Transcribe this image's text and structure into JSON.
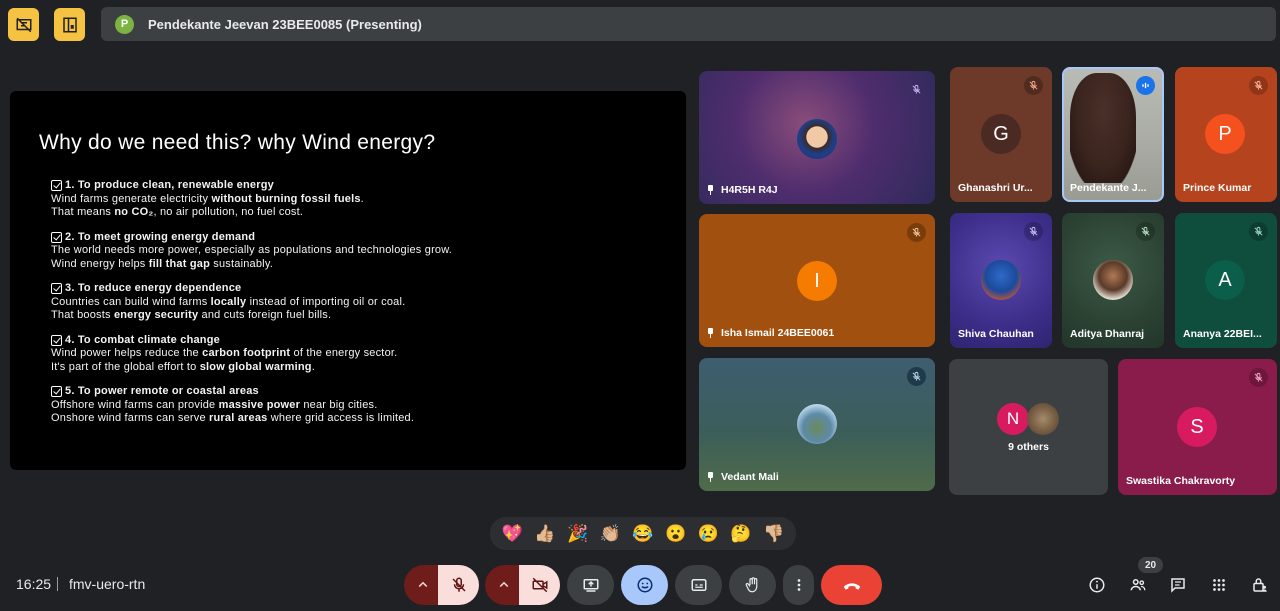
{
  "presenter": {
    "initial": "P",
    "label": "Pendekante Jeevan 23BEE0085 (Presenting)"
  },
  "slide": {
    "title": "Why do we need this? why Wind energy?",
    "points": [
      {
        "heading": "1. To produce clean, renewable energy",
        "line1": [
          "Wind farms generate electricity ",
          "without burning fossil fuels",
          "."
        ],
        "line2": [
          "That means ",
          "no CO₂",
          ", no air pollution, no fuel cost."
        ]
      },
      {
        "heading": "2. To meet growing energy demand",
        "line1": [
          "The world needs more power, especially as populations and technologies grow.",
          "",
          ""
        ],
        "line2": [
          "Wind energy helps ",
          "fill that gap",
          " sustainably."
        ]
      },
      {
        "heading": "3. To reduce energy dependence",
        "line1": [
          "Countries can build wind farms ",
          "locally",
          " instead of importing oil or coal."
        ],
        "line2": [
          "That boosts ",
          "energy security",
          " and cuts foreign fuel bills."
        ]
      },
      {
        "heading": "4. To combat climate change",
        "line1": [
          "Wind power helps reduce the ",
          "carbon footprint",
          " of the energy sector."
        ],
        "line2": [
          "It's part of the global effort to ",
          "slow global warming",
          "."
        ]
      },
      {
        "heading": "5. To power remote or coastal areas",
        "line1": [
          "Offshore wind farms can provide ",
          "massive power",
          " near big cities."
        ],
        "line2": [
          "Onshore wind farms can serve ",
          "rural areas",
          " where grid access is limited."
        ]
      }
    ]
  },
  "participants": {
    "h4r5h": "H4R5H R4J",
    "ghanashri": {
      "name": "Ghanashri Ur...",
      "initial": "G"
    },
    "pendekante": "Pendekante J...",
    "prince": {
      "name": "Prince Kumar",
      "initial": "P"
    },
    "isha": {
      "name": "Isha Ismail 24BEE0061",
      "initial": "I"
    },
    "shiva": "Shiva Chauhan",
    "aditya": "Aditya Dhanraj",
    "ananya": {
      "name": "Ananya 22BEI...",
      "initial": "A"
    },
    "vedant": "Vedant Mali",
    "others": {
      "label": "9 others",
      "initial": "N"
    },
    "swastika": {
      "name": "Swastika Chakravorty",
      "initial": "S"
    }
  },
  "reactions": [
    "💖",
    "👍🏼",
    "🎉",
    "👏🏼",
    "😂",
    "😮",
    "😢",
    "🤔",
    "👎🏼"
  ],
  "footer": {
    "time": "16:25",
    "meeting_code": "fmv-uero-rtn",
    "participant_count": "20"
  },
  "colors": {
    "accent_yellow": "#f5c242",
    "end_call_red": "#ea4335",
    "control_dark_red": "#6f1d1b",
    "control_pink": "#f9dedc",
    "emoji_button_blue": "#a8c7fa"
  }
}
